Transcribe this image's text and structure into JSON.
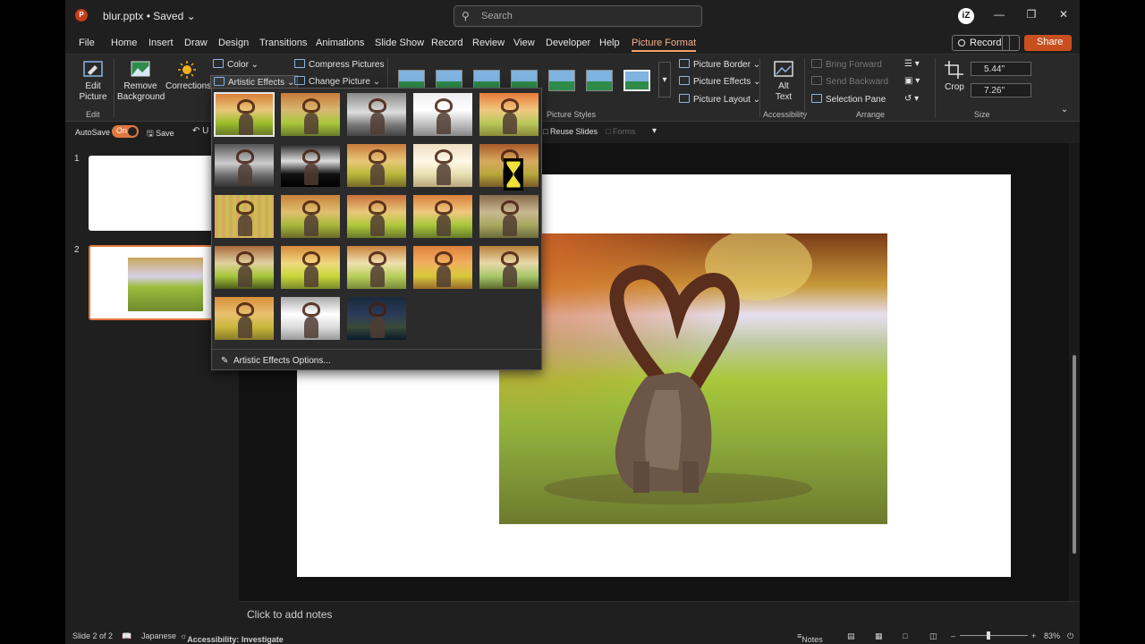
{
  "title_bar": {
    "app_logo": "P",
    "document": "blur.pptx • Saved ⌄",
    "search_placeholder": "Search",
    "avatar": "iZ"
  },
  "tabs": [
    "File",
    "Home",
    "Insert",
    "Draw",
    "Design",
    "Transitions",
    "Animations",
    "Slide Show",
    "Record",
    "Review",
    "View",
    "Developer",
    "Help",
    "Picture Format"
  ],
  "active_tab": "Picture Format",
  "header_buttons": {
    "record": "Record",
    "share": "Share ⌄"
  },
  "ribbon": {
    "edit_picture": "Edit Picture",
    "edit_group": "Edit",
    "remove_background": "Remove Background",
    "corrections": "Corrections",
    "color": "Color ⌄",
    "artistic_effects": "Artistic Effects ⌄",
    "compress_pictures": "Compress Pictures",
    "change_picture": "Change Picture ⌄",
    "picture_styles_group": "Picture Styles",
    "picture_border": "Picture Border ⌄",
    "picture_effects": "Picture Effects ⌄",
    "picture_layout": "Picture Layout ⌄",
    "alt_text": "Alt Text",
    "accessibility_group": "Accessibility",
    "bring_forward": "Bring Forward",
    "send_backward": "Send Backward",
    "selection_pane": "Selection Pane",
    "arrange_group": "Arrange",
    "crop": "Crop",
    "height": "5.44\"",
    "width": "7.26\"",
    "size_group": "Size"
  },
  "qat": {
    "autosave": "AutoSave",
    "toggle": "On",
    "save": "Save",
    "undo": "U",
    "reuse_slides": "Reuse Slides",
    "forms": "Forms"
  },
  "slides": [
    "1",
    "2"
  ],
  "artistic_effects_menu": {
    "option": "Artistic Effects Options...",
    "effect_count": 23,
    "selected_index": 0
  },
  "notes_placeholder": "Click to add notes",
  "status_bar": {
    "slide_info": "Slide 2 of 2",
    "language": "Japanese",
    "accessibility": "Accessibility: Investigate",
    "notes": "Notes",
    "zoom": "83%"
  },
  "colors": {
    "accent": "#f5a06a",
    "share_bg": "#c94f1f",
    "toggle_on": "#e07840"
  }
}
